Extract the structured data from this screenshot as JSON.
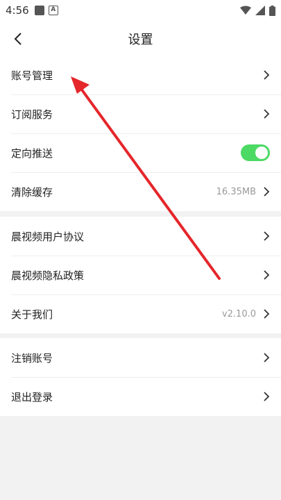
{
  "status_bar": {
    "time": "4:56",
    "icons": [
      "app-notification-icon",
      "a-badge-icon",
      "wifi-icon",
      "signal-icon",
      "battery-icon"
    ],
    "a_badge_letter": "A"
  },
  "header": {
    "title": "设置",
    "back_icon": "chevron-left-icon"
  },
  "sections": [
    {
      "items": [
        {
          "label": "账号管理",
          "type": "link"
        },
        {
          "label": "订阅服务",
          "type": "link"
        },
        {
          "label": "定向推送",
          "type": "toggle",
          "enabled": true
        },
        {
          "label": "清除缓存",
          "type": "link",
          "value": "16.35MB"
        }
      ]
    },
    {
      "items": [
        {
          "label": "晨视频用户协议",
          "type": "link"
        },
        {
          "label": "晨视频隐私政策",
          "type": "link"
        },
        {
          "label": "关于我们",
          "type": "link",
          "value": "v2.10.0"
        }
      ]
    },
    {
      "items": [
        {
          "label": "注销账号",
          "type": "link"
        },
        {
          "label": "退出登录",
          "type": "link"
        }
      ]
    }
  ],
  "colors": {
    "toggle_on": "#4cd964",
    "annotation_arrow": "#e5262a",
    "background": "#f2f2f2"
  },
  "annotation": {
    "type": "arrow",
    "points_to": "账号管理"
  }
}
